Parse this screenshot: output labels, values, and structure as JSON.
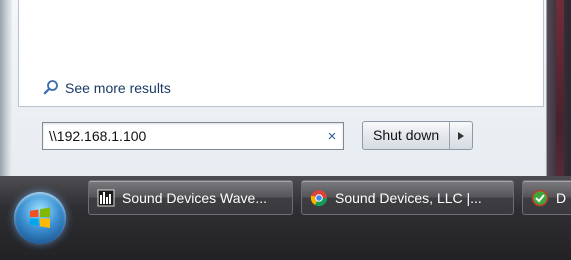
{
  "start_menu": {
    "see_more_label": "See more results",
    "search": {
      "value": "\\\\192.168.1.100",
      "clear_glyph": "×"
    },
    "shutdown": {
      "label": "Shut down",
      "arrow_glyph": "▸"
    }
  },
  "taskbar": {
    "buttons": [
      {
        "label": "Sound Devices Wave...",
        "icon": "wavetool-icon"
      },
      {
        "label": "Sound Devices, LLC |...",
        "icon": "chrome-icon"
      },
      {
        "label": "D",
        "icon": "app-icon"
      }
    ]
  },
  "colors": {
    "taskbar": "#2f2f33",
    "link": "#1c3a66",
    "accent_blue": "#3a8fd1"
  }
}
